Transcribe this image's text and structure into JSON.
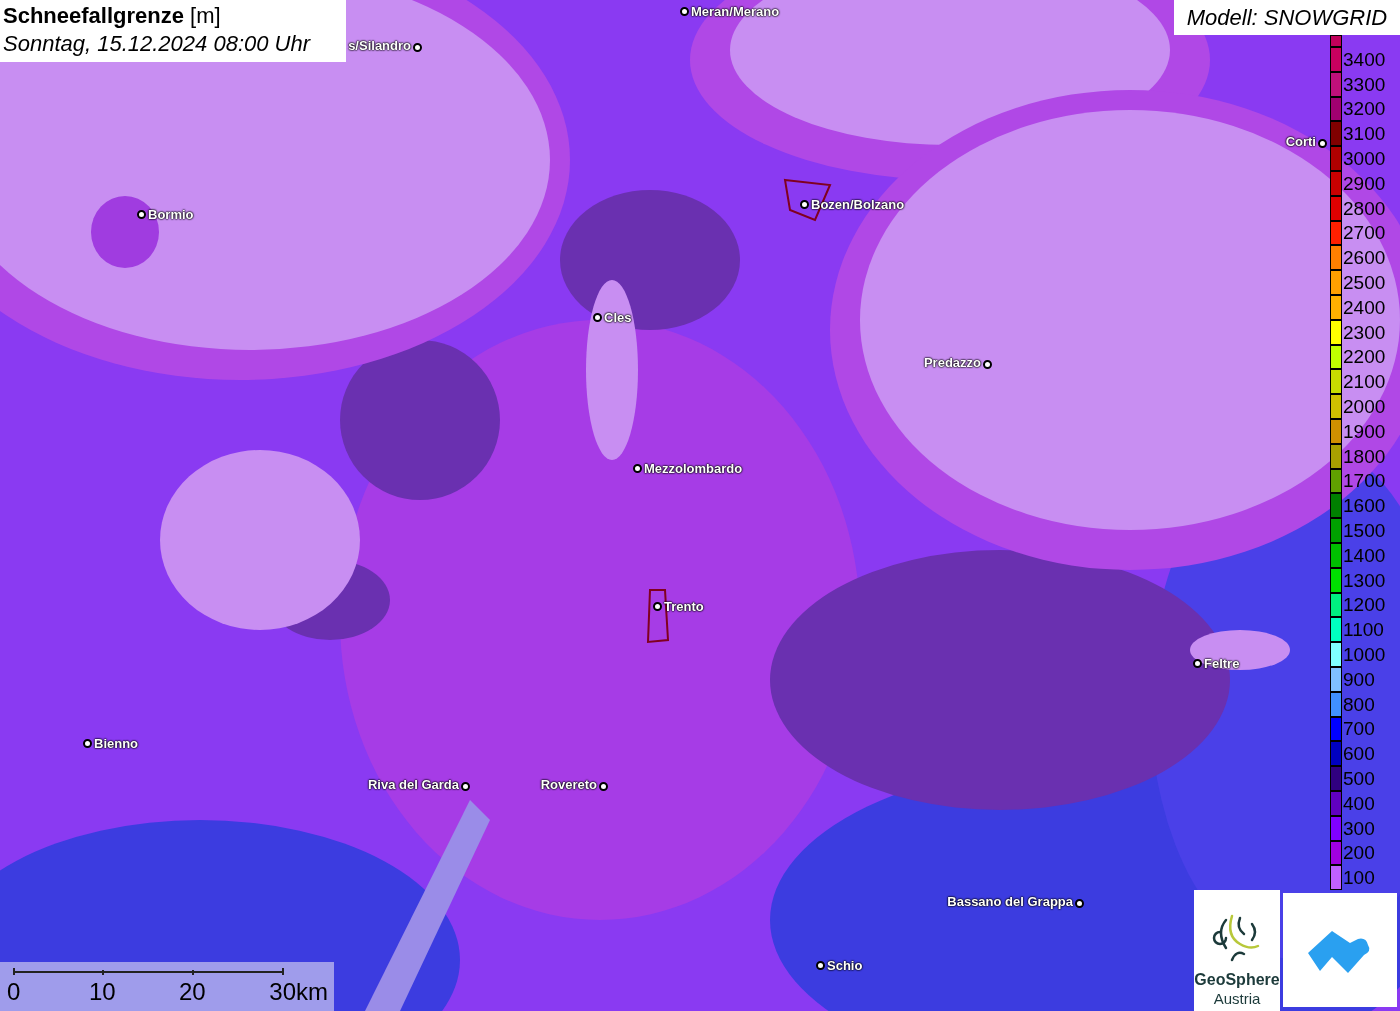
{
  "title": {
    "heading": "**Schneefallgrenze** [m]",
    "time": "Sonntag, 15.12.2024 08:00 Uhr"
  },
  "model_label": "Modell: SNOWGRID",
  "places": [
    {
      "name": "Meran/Merano"
    },
    {
      "name": "s/Silandro"
    },
    {
      "name": "Bormio"
    },
    {
      "name": "Bozen/Bolzano"
    },
    {
      "name": "Cles"
    },
    {
      "name": "Predazzo"
    },
    {
      "name": "Mezzolombardo"
    },
    {
      "name": "Trento"
    },
    {
      "name": "Feltre"
    },
    {
      "name": "Bienno"
    },
    {
      "name": "Riva del Garda"
    },
    {
      "name": "Rovereto"
    },
    {
      "name": "Bassano del Grappa"
    },
    {
      "name": "Schio"
    },
    {
      "name": "Corti"
    }
  ],
  "legend": [
    {
      "color": "#c0005a"
    },
    {
      "label": "3400",
      "color": "#c8005f"
    },
    {
      "label": "3300",
      "color": "#c0107a"
    },
    {
      "label": "3200",
      "color": "#a00070"
    },
    {
      "label": "3100",
      "color": "#800000"
    },
    {
      "label": "3000",
      "color": "#b00000"
    },
    {
      "label": "2900",
      "color": "#c80000"
    },
    {
      "label": "2800",
      "color": "#e00000"
    },
    {
      "label": "2700",
      "color": "#ff2000"
    },
    {
      "label": "2600",
      "color": "#ff8000"
    },
    {
      "label": "2500",
      "color": "#ffa000"
    },
    {
      "label": "2400",
      "color": "#ffb000"
    },
    {
      "label": "2300",
      "color": "#ffff00"
    },
    {
      "label": "2200",
      "color": "#c0ff00"
    },
    {
      "label": "2100",
      "color": "#c8dc00"
    },
    {
      "label": "2000",
      "color": "#d0c000"
    },
    {
      "label": "1900",
      "color": "#d09000"
    },
    {
      "label": "1800",
      "color": "#a8a000"
    },
    {
      "label": "1700",
      "color": "#60a000"
    },
    {
      "label": "1600",
      "color": "#008000"
    },
    {
      "label": "1500",
      "color": "#00a000"
    },
    {
      "label": "1400",
      "color": "#00c000"
    },
    {
      "label": "1300",
      "color": "#00e000"
    },
    {
      "label": "1200",
      "color": "#00f080"
    },
    {
      "label": "1100",
      "color": "#00ffc0"
    },
    {
      "label": "1000",
      "color": "#80ffff"
    },
    {
      "label": "900",
      "color": "#80c0ff"
    },
    {
      "label": "800",
      "color": "#4090ff"
    },
    {
      "label": "700",
      "color": "#0000ff"
    },
    {
      "label": "600",
      "color": "#0000c0"
    },
    {
      "label": "500",
      "color": "#300080"
    },
    {
      "label": "400",
      "color": "#6000c0"
    },
    {
      "label": "300",
      "color": "#8000ff"
    },
    {
      "label": "200",
      "color": "#a000e0"
    },
    {
      "label": "100",
      "color": "#c060ff"
    }
  ],
  "scale_bar": {
    "ticks": [
      "0",
      "10",
      "20",
      "30km"
    ]
  },
  "logos": [
    {
      "kind": "geosphere",
      "lines": [
        "GeoSphere",
        "Austria"
      ]
    },
    {
      "kind": "mountain-cloud"
    }
  ]
}
